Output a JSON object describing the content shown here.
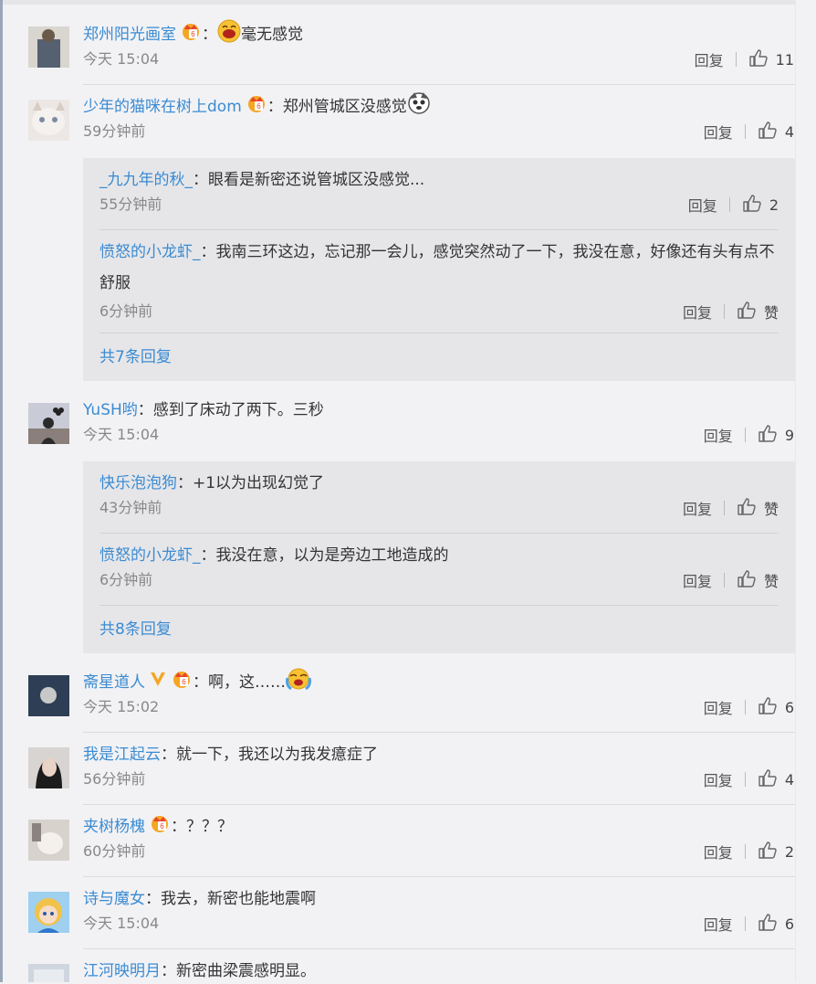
{
  "reply_label": "回复",
  "c1": {
    "user": "郑州阳光画室",
    "text": "毫无感觉",
    "time": "今天 15:04",
    "likes": "11"
  },
  "c2": {
    "user": "少年的猫咪在树上dom",
    "text": "郑州管城区没感觉",
    "time": "59分钟前",
    "likes": "4",
    "replies": [
      {
        "user": "_九九年的秋_",
        "text": "眼看是新密还说管城区没感觉...",
        "time": "55分钟前",
        "likes": "2"
      },
      {
        "user": "愤怒的小龙虾_",
        "text": "我南三环这边，忘记那一会儿，感觉突然动了一下，我没在意，好像还有头有点不舒服",
        "time": "6分钟前",
        "likes": "赞"
      }
    ],
    "more": "共7条回复"
  },
  "c3": {
    "user": "YuSH哟",
    "text": "感到了床动了两下。三秒",
    "time": "今天 15:04",
    "likes": "9",
    "replies": [
      {
        "user": "快乐泡泡狗",
        "text": "+1以为出现幻觉了",
        "time": "43分钟前",
        "likes": "赞"
      },
      {
        "user": "愤怒的小龙虾_",
        "text": "我没在意，以为是旁边工地造成的",
        "time": "6分钟前",
        "likes": "赞"
      }
    ],
    "more": "共8条回复"
  },
  "c4": {
    "user": "斋星道人",
    "text": "啊，这……",
    "time": "今天 15:02",
    "likes": "6"
  },
  "c5": {
    "user": "我是江起云",
    "text": "就一下，我还以为我发癔症了",
    "time": "56分钟前",
    "likes": "4"
  },
  "c6": {
    "user": "夹树杨槐",
    "text": "？？？",
    "time": "60分钟前",
    "likes": "2"
  },
  "c7": {
    "user": "诗与魔女",
    "text": "我去，新密也能地震啊",
    "time": "今天 15:04",
    "likes": "6"
  },
  "c8": {
    "user": "江河映明月",
    "text": "新密曲梁震感明显。"
  },
  "icons": {
    "like": "thumbs-up-icon",
    "badge": "vip-crown-badge-icon",
    "verified": "verified-v-icon"
  }
}
